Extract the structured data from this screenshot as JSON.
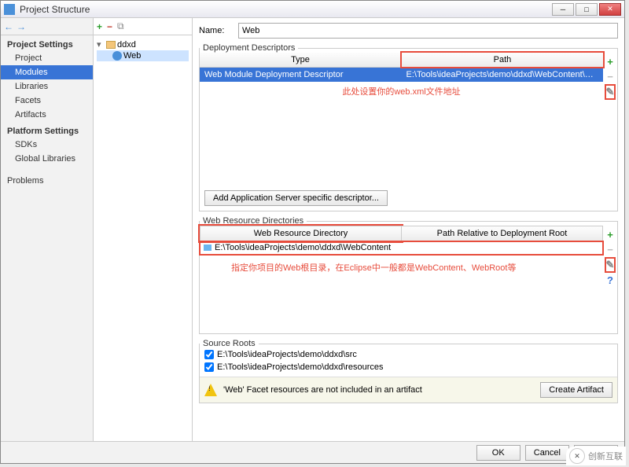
{
  "window": {
    "title": "Project Structure"
  },
  "sidebar": {
    "sections": [
      {
        "title": "Project Settings",
        "items": [
          "Project",
          "Modules",
          "Libraries",
          "Facets",
          "Artifacts"
        ],
        "selected": 1
      },
      {
        "title": "Platform Settings",
        "items": [
          "SDKs",
          "Global Libraries"
        ]
      },
      {
        "title": "",
        "items": [
          "Problems"
        ]
      }
    ]
  },
  "tree": {
    "root": {
      "label": "ddxd"
    },
    "child": {
      "label": "Web"
    }
  },
  "name": {
    "label": "Name:",
    "value": "Web"
  },
  "dd": {
    "legend": "Deployment Descriptors",
    "headers": {
      "type": "Type",
      "path": "Path"
    },
    "row": {
      "type": "Web Module Deployment Descriptor",
      "path": "E:\\Tools\\ideaProjects\\demo\\ddxd\\WebContent\\WEB-INF\\web."
    },
    "hint": "此处设置你的web.xml文件地址",
    "addBtn": "Add Application Server specific descriptor..."
  },
  "wrd": {
    "legend": "Web Resource Directories",
    "headers": {
      "dir": "Web Resource Directory",
      "rel": "Path Relative to Deployment Root"
    },
    "row": {
      "dir": "E:\\Tools\\ideaProjects\\demo\\ddxd\\WebContent",
      "rel": "/"
    },
    "hint": "指定你项目的Web根目录，在Eclipse中一般都是WebContent、WebRoot等"
  },
  "src": {
    "legend": "Source Roots",
    "items": [
      "E:\\Tools\\ideaProjects\\demo\\ddxd\\src",
      "E:\\Tools\\ideaProjects\\demo\\ddxd\\resources"
    ]
  },
  "warning": {
    "text": "'Web' Facet resources are not included in an artifact",
    "btn": "Create Artifact"
  },
  "footer": {
    "ok": "OK",
    "cancel": "Cancel",
    "apply": "Ap"
  },
  "watermark": {
    "text": "创新互联"
  }
}
